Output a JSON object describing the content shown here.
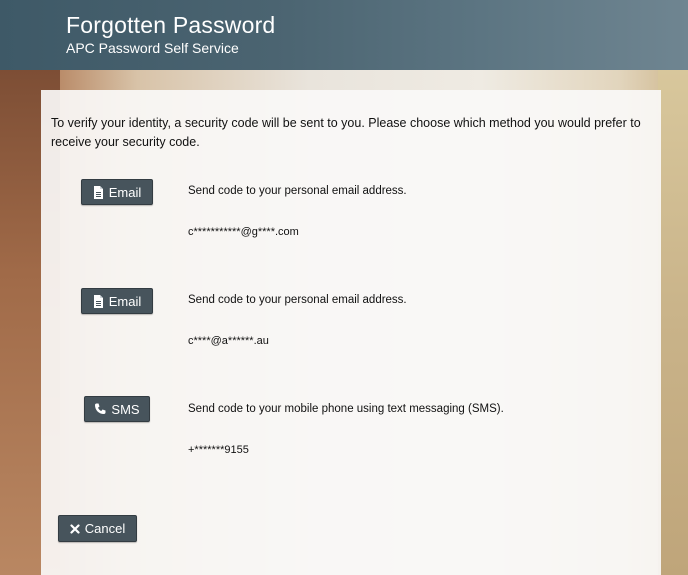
{
  "header": {
    "title": "Forgotten Password",
    "subtitle": "APC Password Self Service"
  },
  "intro": "To verify your identity, a security code will be sent to you. Please choose which method you would prefer to receive your security code.",
  "methods": [
    {
      "button_label": "Email",
      "icon": "document-icon",
      "description": "Send code to your personal email address.",
      "destination": "c***********@g****.com"
    },
    {
      "button_label": "Email",
      "icon": "document-icon",
      "description": "Send code to your personal email address.",
      "destination": "c****@a******.au"
    },
    {
      "button_label": "SMS",
      "icon": "phone-icon",
      "description": "Send code to your mobile phone using text messaging (SMS).",
      "destination": "+*******9155"
    }
  ],
  "cancel_label": "Cancel",
  "colors": {
    "header": "#4b6471",
    "button": "#47545c"
  }
}
